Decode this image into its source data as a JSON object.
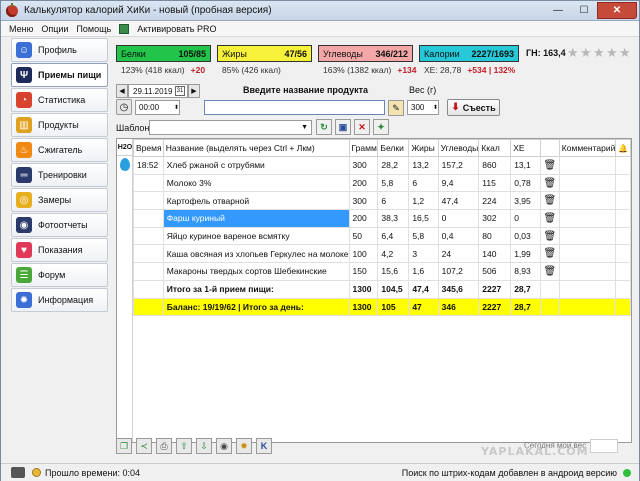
{
  "window": {
    "title": "Калькулятор калорий ХиКи - новый (пробная версия)",
    "minimize": "—",
    "maximize": "☐",
    "close": "✕"
  },
  "menu": {
    "items": [
      "Меню",
      "Опции",
      "Помощь"
    ],
    "activate": "Активировать PRO"
  },
  "sidebar": {
    "items": [
      {
        "label": "Профиль",
        "icon": "person-icon",
        "color": "#3b6fd6",
        "glyph": "☺"
      },
      {
        "label": "Приемы пищи",
        "icon": "fork-knife-icon",
        "color": "#1e2a5a",
        "glyph": "Ψ"
      },
      {
        "label": "Статистика",
        "icon": "pie-chart-icon",
        "color": "#d7432c",
        "glyph": "◔"
      },
      {
        "label": "Продукты",
        "icon": "groceries-icon",
        "color": "#e0a020",
        "glyph": "▥"
      },
      {
        "label": "Сжигатель",
        "icon": "flame-icon",
        "color": "#f08a14",
        "glyph": "♨"
      },
      {
        "label": "Тренировки",
        "icon": "dumbbell-icon",
        "color": "#2a3a6a",
        "glyph": "═"
      },
      {
        "label": "Замеры",
        "icon": "tape-measure-icon",
        "color": "#e8b020",
        "glyph": "◎"
      },
      {
        "label": "Фотоотчеты",
        "icon": "camera-icon",
        "color": "#2a3a6a",
        "glyph": "◉"
      },
      {
        "label": "Показания",
        "icon": "heart-pulse-icon",
        "color": "#e03a5a",
        "glyph": "♥"
      },
      {
        "label": "Форум",
        "icon": "chat-bubbles-icon",
        "color": "#4aa83a",
        "glyph": "☰"
      },
      {
        "label": "Информация",
        "icon": "lightbulb-icon",
        "color": "#3b6fd6",
        "glyph": "✹"
      }
    ],
    "active_index": 1
  },
  "macros": {
    "protein": {
      "label": "Белки",
      "value": "105/85",
      "pct": "123% (418 ккал)",
      "delta": "+20",
      "color": "#22c44a"
    },
    "fat": {
      "label": "Жиры",
      "value": "47/56",
      "pct": "85% (426 ккал)",
      "delta": "",
      "color": "#f6f23a"
    },
    "carbs": {
      "label": "Углеводы",
      "value": "346/212",
      "pct": "163% (1382 ккал)",
      "delta": "+134",
      "color": "#f4a7a7"
    },
    "calories": {
      "label": "Калории",
      "value": "2227/1693",
      "pct": "ХЕ: 28,78",
      "delta": "+534 | 132%",
      "color": "#27c8d8"
    },
    "gn": "ГН: 163,4",
    "stars": 5
  },
  "entry": {
    "date": "29.11.2019",
    "product_label": "Введите название продукта",
    "weight_label": "Вес (г)",
    "time": "00:00",
    "product_value": "",
    "weight": "300",
    "eat_button": "Съесть",
    "template_label": "Шаблон",
    "template_value": ""
  },
  "table": {
    "h2o": "H2O",
    "columns": [
      "Время",
      "Название (выделять через Ctrl + Лкм)",
      "Грамм",
      "Белки",
      "Жиры",
      "Углеводы",
      "Ккал",
      "ХЕ",
      "",
      "Комментарий",
      "🔔"
    ],
    "rows": [
      [
        "18:52",
        "Хлеб ржаной с отрубями",
        "300",
        "28,2",
        "13,2",
        "157,2",
        "860",
        "13,1"
      ],
      [
        "",
        "Молоко 3%",
        "200",
        "5,8",
        "6",
        "9,4",
        "115",
        "0,78"
      ],
      [
        "",
        "Картофель отварной",
        "300",
        "6",
        "1,2",
        "47,4",
        "224",
        "3,95"
      ],
      [
        "",
        "Фарш куриный",
        "200",
        "38,3",
        "16,5",
        "0",
        "302",
        "0"
      ],
      [
        "",
        "Яйцо куриное вареное всмятку",
        "50",
        "6,4",
        "5,8",
        "0,4",
        "80",
        "0,03"
      ],
      [
        "",
        "Каша овсяная из хлопьев Геркулес на молоке",
        "100",
        "4,2",
        "3",
        "24",
        "140",
        "1,99"
      ],
      [
        "",
        "Макароны твердых сортов Шебекинские",
        "150",
        "15,6",
        "1,6",
        "107,2",
        "506",
        "8,93"
      ]
    ],
    "selected_row": 3,
    "total": [
      "",
      "Итого за 1-й прием пищи:",
      "1300",
      "104,5",
      "47,4",
      "345,6",
      "2227",
      "28,7"
    ],
    "balance": [
      "",
      "Баланс: 19/19/62  |  Итого за день:",
      "1300",
      "105",
      "47",
      "346",
      "2227",
      "28,7"
    ]
  },
  "footer": {
    "today_weight_label": "Сегодня мой вес",
    "elapsed_label": "Прошло времени: 0:04",
    "status_message": "Поиск по штрих-кодам добавлен в андроид версию",
    "watermark": "YAPLAKAL.COM"
  }
}
